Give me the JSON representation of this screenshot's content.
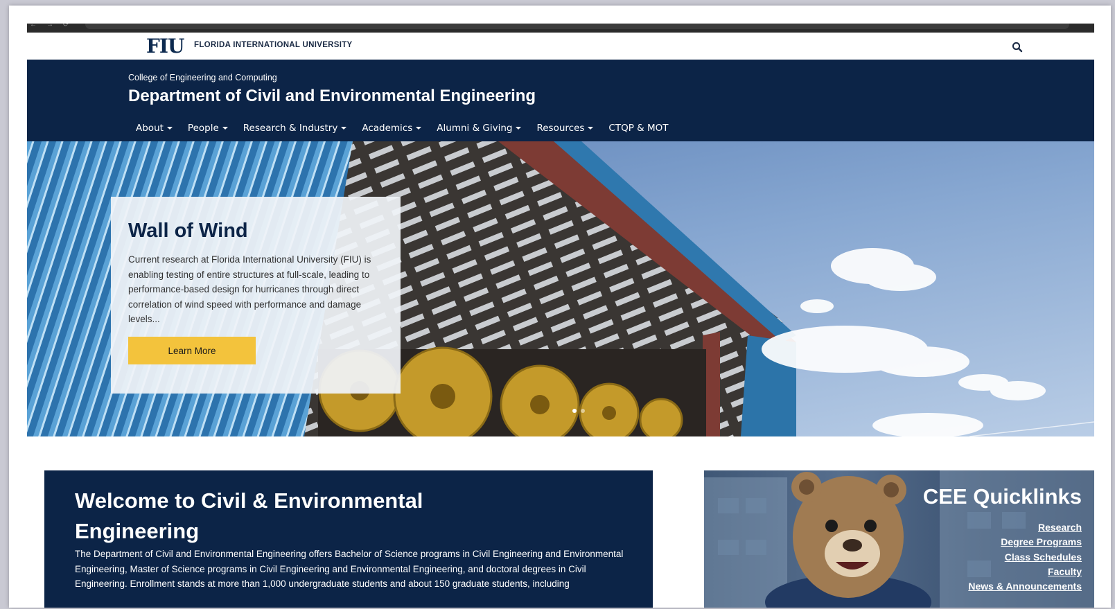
{
  "browser": {
    "address_text": "localhost"
  },
  "brand": {
    "logo_text": "FIU",
    "university_name": "FLORIDA INTERNATIONAL UNIVERSITY",
    "navy": "#0c2447",
    "gold": "#f3c33c"
  },
  "header": {
    "college": "College of Engineering and Computing",
    "department": "Department of Civil and Environmental Engineering"
  },
  "nav": {
    "items": [
      {
        "label": "About",
        "dropdown": true
      },
      {
        "label": "People",
        "dropdown": true
      },
      {
        "label": "Research & Industry",
        "dropdown": true
      },
      {
        "label": "Academics",
        "dropdown": true
      },
      {
        "label": "Alumni & Giving",
        "dropdown": true
      },
      {
        "label": "Resources",
        "dropdown": true
      },
      {
        "label": "CTQP & MOT",
        "dropdown": false
      }
    ]
  },
  "hero": {
    "title": "Wall of Wind",
    "text": "Current research at Florida International University (FIU) is enabling testing of entire structures at full-scale, leading to performance-based design for hurricanes through direct correlation of wind speed with performance and damage levels...",
    "button_label": "Learn More",
    "active_slide": 1,
    "slide_count": 2
  },
  "welcome": {
    "title": "Welcome to Civil & Environmental Engineering",
    "text": "The Department of Civil and Environmental Engineering offers Bachelor of Science programs in Civil Engineering and Environmental Engineering, Master of Science programs in Civil Engineering and Environmental Engineering, and doctoral degrees in Civil Engineering. Enrollment stands at more than 1,000 undergraduate students and about 150 graduate students, including"
  },
  "quicklinks": {
    "title": "CEE Quicklinks",
    "links": [
      "Research",
      "Degree Programs",
      "Class Schedules",
      "Faculty",
      "News & Announcements"
    ]
  },
  "icons": {
    "search": "search-icon"
  }
}
